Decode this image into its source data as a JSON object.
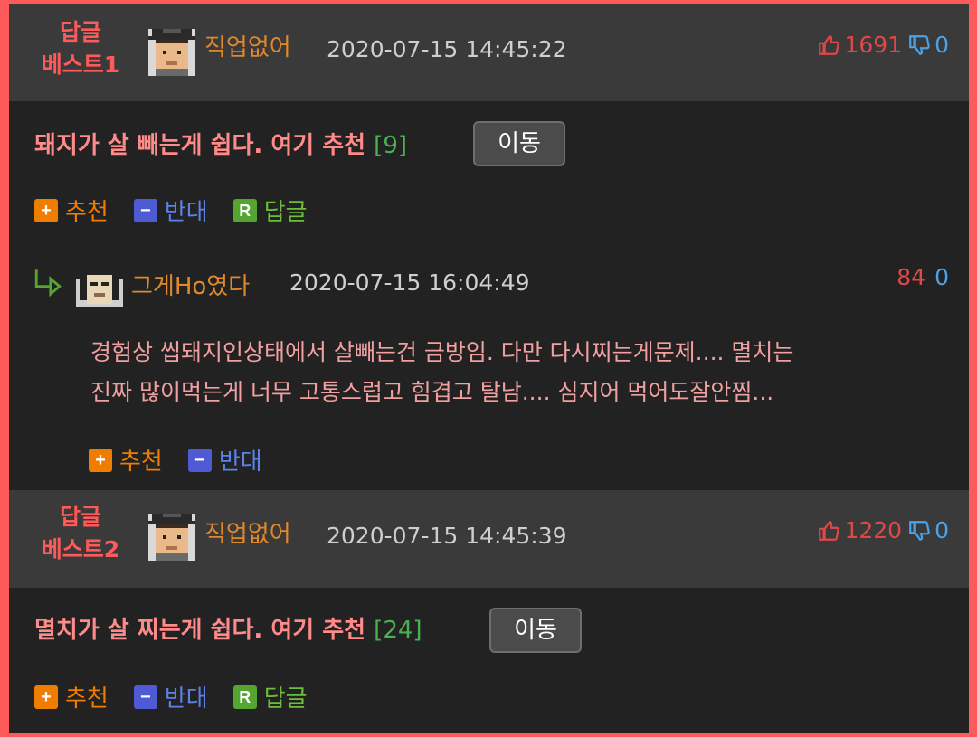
{
  "colors": {
    "accent": "#ff5a5a",
    "nick": "#e0892c",
    "up": "#e04848",
    "down": "#4aa3e6",
    "recommend": "#ef7d00",
    "oppose": "#4f5bd5",
    "reply": "#55a630"
  },
  "best1": {
    "rank_line1": "답글",
    "rank_line2": "베스트1",
    "nickname": "직업없어",
    "timestamp": "2020-07-15 14:45:22",
    "up_count": "1691",
    "down_count": "0",
    "title": "돼지가 살 빼는게 쉽다. 여기 추천",
    "reply_count": "[9]",
    "move_label": "이동",
    "actions": {
      "recommend": "추천",
      "oppose": "반대",
      "reply": "답글",
      "plus_symbol": "+",
      "minus_symbol": "−",
      "r_symbol": "R"
    },
    "reply": {
      "nickname": "그게Ho였다",
      "timestamp": "2020-07-15 16:04:49",
      "up_count": "84",
      "down_count": "0",
      "line1": "경험상 씹돼지인상태에서 살빼는건 금방임. 다만 다시찌는게문제.... 멸치는",
      "line2": "진짜 많이먹는게 너무 고통스럽고 힘겹고 탈남.... 심지어 먹어도잘안찜...",
      "recommend": "추천",
      "oppose": "반대"
    }
  },
  "best2": {
    "rank_line1": "답글",
    "rank_line2": "베스트2",
    "nickname": "직업없어",
    "timestamp": "2020-07-15 14:45:39",
    "up_count": "1220",
    "down_count": "0",
    "title": "멸치가 살 찌는게 쉽다. 여기 추천",
    "reply_count": "[24]",
    "move_label": "이동",
    "actions": {
      "recommend": "추천",
      "oppose": "반대",
      "reply": "답글"
    }
  }
}
